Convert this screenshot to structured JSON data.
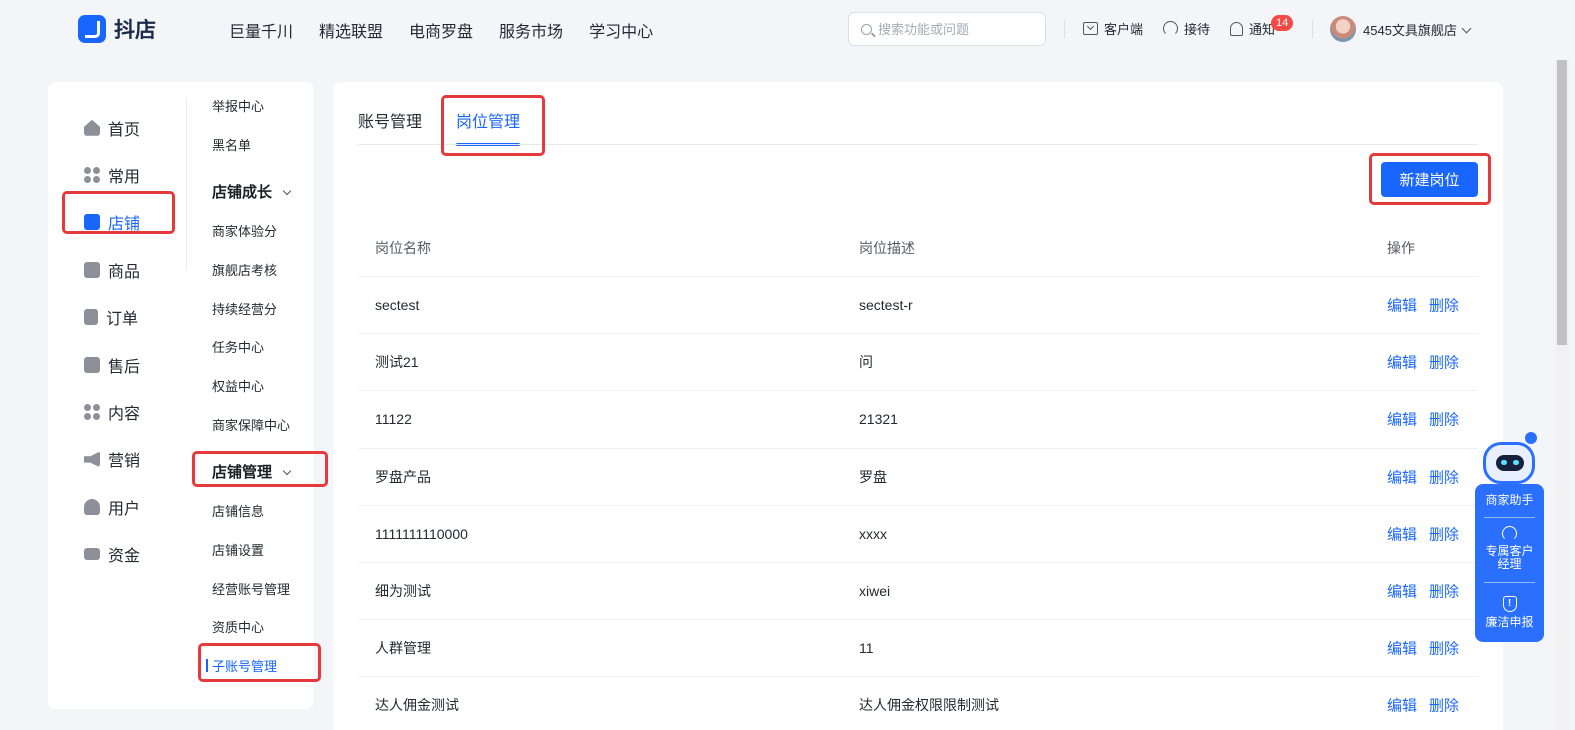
{
  "header": {
    "logo_text": "抖店",
    "nav": [
      "巨量千川",
      "精选联盟",
      "电商罗盘",
      "服务市场",
      "学习中心"
    ],
    "search_placeholder": "搜索功能或问题",
    "client_label": "客户端",
    "reception_label": "接待",
    "notify_label": "通知",
    "notify_count": "14",
    "shop_name": "4545文具旗舰店"
  },
  "primary_nav": [
    {
      "label": "首页",
      "icon": "home-icon"
    },
    {
      "label": "常用",
      "icon": "grid-icon"
    },
    {
      "label": "店铺",
      "icon": "store-icon",
      "active": true
    },
    {
      "label": "商品",
      "icon": "product-icon"
    },
    {
      "label": "订单",
      "icon": "order-icon"
    },
    {
      "label": "售后",
      "icon": "after-sale-icon"
    },
    {
      "label": "内容",
      "icon": "content-icon"
    },
    {
      "label": "营销",
      "icon": "speaker-icon"
    },
    {
      "label": "用户",
      "icon": "user-icon"
    },
    {
      "label": "资金",
      "icon": "wallet-icon"
    }
  ],
  "secondary_nav": {
    "top_items": [
      "举报中心",
      "黑名单"
    ],
    "group_growth": "店铺成长",
    "growth_items": [
      "商家体验分",
      "旗舰店考核",
      "持续经营分",
      "任务中心",
      "权益中心",
      "商家保障中心"
    ],
    "group_manage": "店铺管理",
    "manage_items": [
      "店铺信息",
      "店铺设置",
      "经营账号管理",
      "资质中心",
      "子账号管理"
    ]
  },
  "tabs": [
    "账号管理",
    "岗位管理"
  ],
  "new_button": "新建岗位",
  "table": {
    "headers": [
      "岗位名称",
      "岗位描述",
      "操作"
    ],
    "edit_label": "编辑",
    "delete_label": "删除",
    "rows": [
      [
        "sectest",
        "sectest-r"
      ],
      [
        "测试21",
        "问"
      ],
      [
        "11122",
        "21321"
      ],
      [
        "罗盘产品",
        "罗盘"
      ],
      [
        "1111111110000",
        "xxxx"
      ],
      [
        "细为测试",
        "xiwei"
      ],
      [
        "人群管理",
        "11"
      ],
      [
        "达人佣金测试",
        "达人佣金权限限制测试"
      ]
    ]
  },
  "helper": {
    "assistant": "商家助手",
    "manager": "专属客户经理",
    "report": "廉洁申报"
  },
  "colors": {
    "accent": "#1966ff",
    "highlight": "#e5393b"
  }
}
